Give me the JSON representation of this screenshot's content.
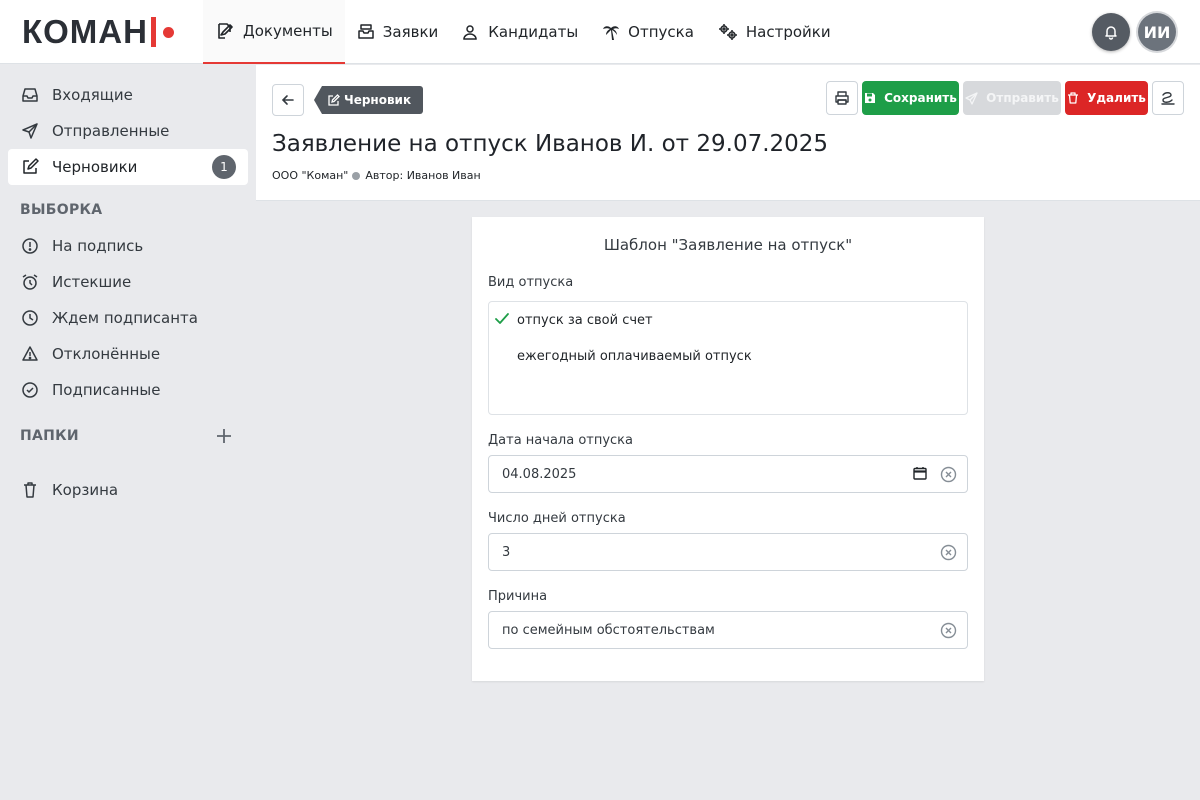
{
  "app": {
    "logo_text": "КОМАН",
    "brand_color": "#e53935",
    "user_initials": "ИИ"
  },
  "nav": {
    "items": [
      {
        "label": "Документы",
        "icon": "document-edit-icon",
        "active": true
      },
      {
        "label": "Заявки",
        "icon": "inbox-stack-icon"
      },
      {
        "label": "Кандидаты",
        "icon": "user-search-icon"
      },
      {
        "label": "Отпуска",
        "icon": "palm-tree-icon"
      },
      {
        "label": "Настройки",
        "icon": "gears-icon"
      }
    ]
  },
  "sidebar": {
    "items": [
      {
        "label": "Входящие",
        "icon": "inbox-icon"
      },
      {
        "label": "Отправленные",
        "icon": "send-icon"
      },
      {
        "label": "Черновики",
        "icon": "edit-icon",
        "badge": "1",
        "active": true
      }
    ],
    "filter_heading": "ВЫБОРКА",
    "filters": [
      {
        "label": "На подпись",
        "icon": "exclamation-circle-icon"
      },
      {
        "label": "Истекшие",
        "icon": "alarm-clock-icon"
      },
      {
        "label": "Ждем подписанта",
        "icon": "clock-icon"
      },
      {
        "label": "Отклонённые",
        "icon": "warning-triangle-icon"
      },
      {
        "label": "Подписанные",
        "icon": "check-circle-icon"
      }
    ],
    "folders_heading": "ПАПКИ",
    "trash_label": "Корзина"
  },
  "document": {
    "status_tag": "Черновик",
    "title": "Заявление на отпуск Иванов И. от 29.07.2025",
    "organization": "ООО \"Коман\"",
    "author": "Автор: Иванов Иван"
  },
  "toolbar": {
    "save_label": "Сохранить",
    "send_label": "Отправить",
    "delete_label": "Удалить",
    "save_color": "#1e9e48",
    "delete_color": "#dc2626"
  },
  "form": {
    "template_title": "Шаблон \"Заявление на отпуск\"",
    "leave_type_label": "Вид отпуска",
    "leave_type_options": [
      {
        "label": "отпуск за свой счет",
        "selected": true
      },
      {
        "label": "ежегодный оплачиваемый отпуск",
        "selected": false
      }
    ],
    "start_date_label": "Дата начала отпуска",
    "start_date_value": "04.08.2025",
    "days_label": "Число дней отпуска",
    "days_value": "3",
    "reason_label": "Причина",
    "reason_value": "по семейным обстоятельствам"
  }
}
